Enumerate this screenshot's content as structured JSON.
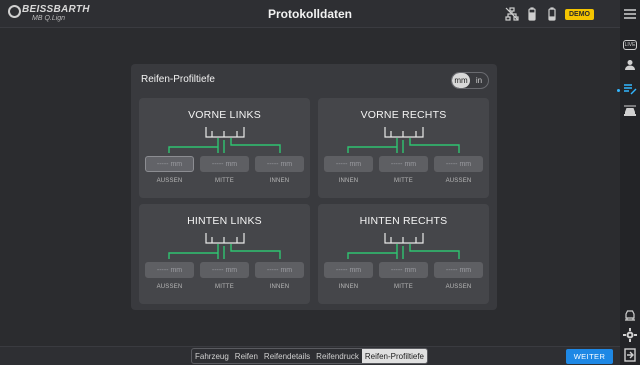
{
  "app": {
    "brand": "BEISSBARTH",
    "brand_sub": "MB Q.Lign",
    "title": "Protokolldaten",
    "demo_badge": "DEMO"
  },
  "sidebar": {
    "live_label": "LIVE",
    "icons": [
      "menu-icon",
      "live-icon",
      "user-icon",
      "list-edit-icon",
      "car-icon",
      "car-lift-icon",
      "gear-icon",
      "logout-icon"
    ]
  },
  "panel": {
    "title": "Reifen-Profiltiefe",
    "units": [
      "mm",
      "in"
    ],
    "selected_unit": "mm",
    "cards": [
      {
        "title": "VORNE LINKS",
        "fields": [
          "----- mm",
          "----- mm",
          "----- mm"
        ],
        "labels": [
          "AUSSEN",
          "MITTE",
          "INNEN"
        ]
      },
      {
        "title": "VORNE RECHTS",
        "fields": [
          "----- mm",
          "----- mm",
          "----- mm"
        ],
        "labels": [
          "INNEN",
          "MITTE",
          "AUSSEN"
        ]
      },
      {
        "title": "HINTEN LINKS",
        "fields": [
          "----- mm",
          "----- mm",
          "----- mm"
        ],
        "labels": [
          "AUSSEN",
          "MITTE",
          "INNEN"
        ]
      },
      {
        "title": "HINTEN RECHTS",
        "fields": [
          "----- mm",
          "----- mm",
          "----- mm"
        ],
        "labels": [
          "INNEN",
          "MITTE",
          "AUSSEN"
        ]
      }
    ]
  },
  "bottom": {
    "tabs": [
      "Fahrzeug",
      "Reifen",
      "Reifendetails",
      "Reifendruck",
      "Reifen-Profiltiefe"
    ],
    "active_tab": "Reifen-Profiltiefe",
    "next_label": "WEITER"
  },
  "colors": {
    "accent": "#1e88e5",
    "diagram_green": "#2fc471",
    "demo": "#f4c400"
  }
}
